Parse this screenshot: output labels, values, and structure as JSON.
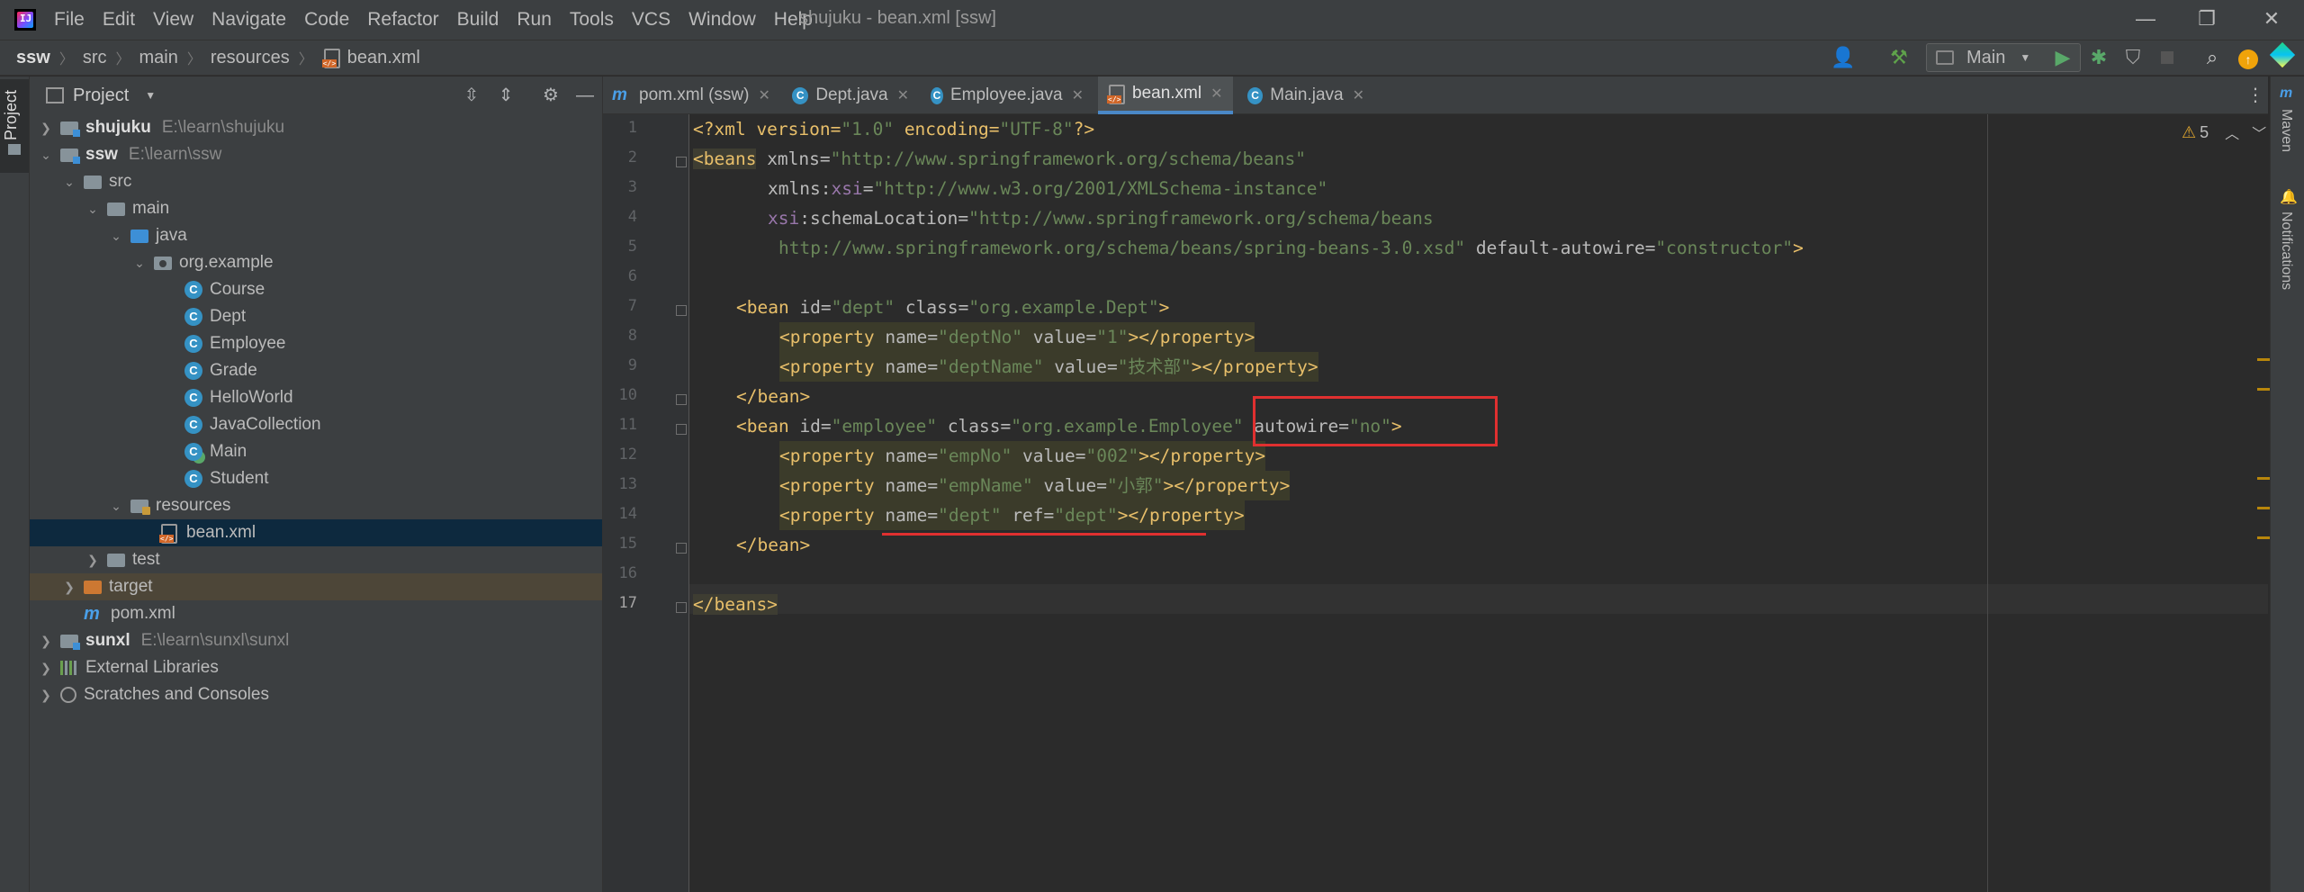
{
  "window": {
    "title": "shujuku - bean.xml [ssw]",
    "menu": [
      "File",
      "Edit",
      "View",
      "Navigate",
      "Code",
      "Refactor",
      "Build",
      "Run",
      "Tools",
      "VCS",
      "Window",
      "Help"
    ]
  },
  "breadcrumbs": [
    "ssw",
    "src",
    "main",
    "resources",
    "bean.xml"
  ],
  "toolbar": {
    "run_config": "Main",
    "icons": [
      "user-icon",
      "build-hammer-icon",
      "run-icon",
      "debug-icon",
      "coverage-icon",
      "stop-icon",
      "search-icon",
      "update-icon",
      "jetbrains-icon"
    ]
  },
  "left_stripe": {
    "project_label": "Project"
  },
  "project_panel": {
    "title": "Project",
    "tree": [
      {
        "label": "shujuku",
        "path": "E:\\learn\\shujuku"
      },
      {
        "label": "ssw",
        "path": "E:\\learn\\ssw"
      },
      {
        "label": "src"
      },
      {
        "label": "main"
      },
      {
        "label": "java"
      },
      {
        "label": "org.example"
      },
      {
        "label": "Course"
      },
      {
        "label": "Dept"
      },
      {
        "label": "Employee"
      },
      {
        "label": "Grade"
      },
      {
        "label": "HelloWorld"
      },
      {
        "label": "JavaCollection"
      },
      {
        "label": "Main"
      },
      {
        "label": "Student"
      },
      {
        "label": "resources"
      },
      {
        "label": "bean.xml"
      },
      {
        "label": "test"
      },
      {
        "label": "target"
      },
      {
        "label": "pom.xml"
      },
      {
        "label": "sunxl",
        "path": "E:\\learn\\sunxl\\sunxl"
      },
      {
        "label": "External Libraries"
      },
      {
        "label": "Scratches and Consoles"
      }
    ]
  },
  "tabs": [
    {
      "label": "pom.xml (ssw)",
      "icon": "maven-icon"
    },
    {
      "label": "Dept.java",
      "icon": "class-icon"
    },
    {
      "label": "Employee.java",
      "icon": "class-icon"
    },
    {
      "label": "bean.xml",
      "icon": "xml-icon",
      "active": true
    },
    {
      "label": "Main.java",
      "icon": "class-icon"
    }
  ],
  "editor": {
    "line_numbers": [
      "1",
      "2",
      "3",
      "4",
      "5",
      "6",
      "7",
      "8",
      "9",
      "10",
      "11",
      "12",
      "13",
      "14",
      "15",
      "16",
      "17"
    ],
    "current_line": 17,
    "inspections": {
      "warnings": "5"
    },
    "code": {
      "l1": {
        "a": "<?xml version=",
        "b": "\"1.0\"",
        "c": " encoding=",
        "d": "\"UTF-8\"",
        "e": "?>"
      },
      "l2": {
        "a": "<beans",
        "b": " xmlns=",
        "c": "\"http://www.springframework.org/schema/beans\""
      },
      "l3": {
        "a": "xmlns:",
        "b": "xsi",
        "c": "=",
        "d": "\"http://www.w3.org/2001/XMLSchema-instance\""
      },
      "l4": {
        "a": "xsi",
        "b": ":schemaLocation=",
        "c": "\"http://www.springframework.org/schema/beans"
      },
      "l5": {
        "a": "http://www.springframework.org/schema/beans/spring-beans-3.0.xsd\"",
        "b": " default-autowire=",
        "c": "\"constructor\"",
        "d": ">"
      },
      "l7": {
        "a": "<bean",
        "b": " id=",
        "c": "\"dept\"",
        "d": " class=",
        "e": "\"org.example.Dept\"",
        "f": ">"
      },
      "l8": {
        "a": "<property",
        "b": " name=",
        "c": "\"deptNo\"",
        "d": " value=",
        "e": "\"1\"",
        "f": "></property>"
      },
      "l9": {
        "a": "<property",
        "b": " name=",
        "c": "\"deptName\"",
        "d": " value=",
        "e": "\"技术部\"",
        "f": "></property>"
      },
      "l10": {
        "a": "</bean>"
      },
      "l11": {
        "a": "<bean",
        "b": " id=",
        "c": "\"employee\"",
        "d": " class=",
        "e": "\"org.example.Employee\"",
        "f": " autowire=",
        "g": "\"no\"",
        "h": ">"
      },
      "l12": {
        "a": "<property",
        "b": " name=",
        "c": "\"empNo\"",
        "d": " value=",
        "e": "\"002\"",
        "f": "></property>"
      },
      "l13": {
        "a": "<property",
        "b": " name=",
        "c": "\"empName\"",
        "d": " value=",
        "e": "\"小郭\"",
        "f": "></property>"
      },
      "l14": {
        "a": "<property",
        "b": " name=",
        "c": "\"dept\"",
        "d": " ref=",
        "e": "\"dept\"",
        "f": "></property>"
      },
      "l15": {
        "a": "</bean>"
      },
      "l17": {
        "a": "</beans>"
      }
    }
  },
  "right_stripe": {
    "maven": "Maven",
    "notifications": "Notifications"
  },
  "colors": {
    "annotation": "#e03030",
    "selection": "#0d293e",
    "accent": "#4a88c7"
  }
}
